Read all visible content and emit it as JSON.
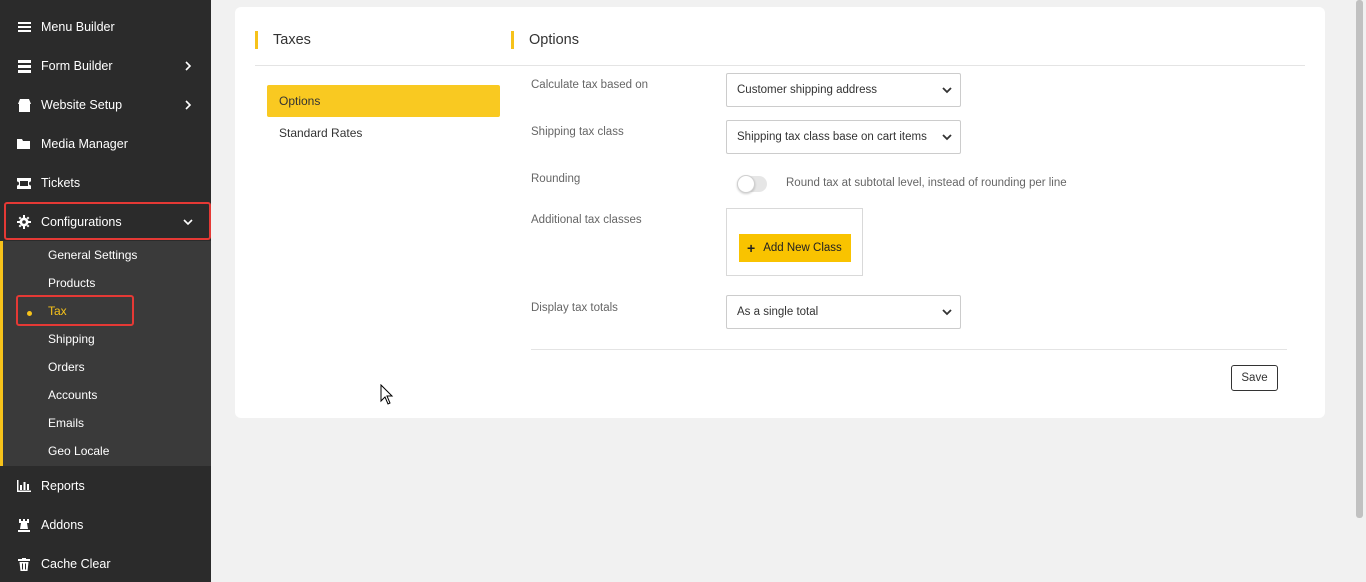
{
  "sidebar": {
    "items": [
      {
        "label": "Menu Builder",
        "icon": "menu-icon"
      },
      {
        "label": "Form Builder",
        "icon": "list-icon"
      },
      {
        "label": "Website Setup",
        "icon": "store-icon"
      },
      {
        "label": "Media Manager",
        "icon": "folder-icon"
      },
      {
        "label": "Tickets",
        "icon": "ticket-icon"
      },
      {
        "label": "Configurations",
        "icon": "gear-icon"
      },
      {
        "label": "Reports",
        "icon": "bar-chart-icon"
      },
      {
        "label": "Addons",
        "icon": "chess-rook-icon"
      },
      {
        "label": "Cache Clear",
        "icon": "trash-icon"
      }
    ],
    "submenu": [
      {
        "label": "General Settings"
      },
      {
        "label": "Products"
      },
      {
        "label": "Tax"
      },
      {
        "label": "Shipping"
      },
      {
        "label": "Orders"
      },
      {
        "label": "Accounts"
      },
      {
        "label": "Emails"
      },
      {
        "label": "Geo Locale"
      }
    ]
  },
  "main": {
    "left_title": "Taxes",
    "right_title": "Options",
    "tabs": [
      {
        "label": "Options"
      },
      {
        "label": "Standard Rates"
      }
    ],
    "form": {
      "calc_label": "Calculate tax based on",
      "calc_value": "Customer shipping address",
      "ship_class_label": "Shipping tax class",
      "ship_class_value": "Shipping tax class base on cart items",
      "rounding_label": "Rounding",
      "rounding_text": "Round tax at subtotal level, instead of rounding per line",
      "additional_label": "Additional tax classes",
      "add_class_button": "Add New Class",
      "display_label": "Display tax totals",
      "display_value": "As a single total",
      "save_label": "Save"
    }
  },
  "colors": {
    "accent": "#f9c921",
    "sidebar_bg": "#2b2b2b",
    "submenu_bg": "#3a3a3a",
    "highlight": "#e53935"
  }
}
